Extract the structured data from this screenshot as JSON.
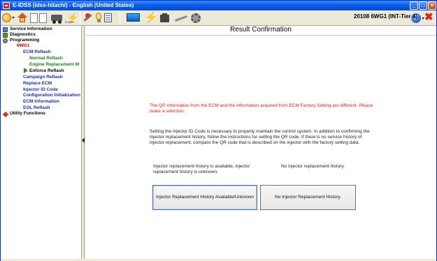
{
  "window": {
    "title": "E-IDSS (idss-hitachi) - English (United States)",
    "min_glyph": "_",
    "max_glyph": "□",
    "close_glyph": "×"
  },
  "toolbar": {
    "flash_label": "FLASH",
    "vehicle_info": "20108 6WG1 (INT-Tier 4)",
    "help_glyph": "?",
    "exit_glyph": "✖",
    "bolt_glyph": "⚡"
  },
  "sidebar": {
    "items": [
      {
        "label": "Service Information",
        "level": 0
      },
      {
        "label": "Diagnostics",
        "level": 0
      },
      {
        "label": "Programming",
        "level": 0
      },
      {
        "label": "6WG1",
        "level": 1
      },
      {
        "label": "ECM Reflash",
        "level": 2
      },
      {
        "label": "Normal Reflash",
        "level": 3
      },
      {
        "label": "Engine Replacement M",
        "level": 3
      },
      {
        "label": "Enforce Reflash",
        "level": 3,
        "selected": true
      },
      {
        "label": "Campaign Reflash",
        "level": 2
      },
      {
        "label": "Replace ECM",
        "level": 2
      },
      {
        "label": "Injector ID Code",
        "level": 2
      },
      {
        "label": "Configuration Initialization",
        "level": 2
      },
      {
        "label": "ECM Information",
        "level": 2
      },
      {
        "label": "EOL Reflash",
        "level": 2
      },
      {
        "label": "Utility Functions",
        "level": 0
      }
    ]
  },
  "main": {
    "title": "Result Confirmation",
    "warning": "The QR information from the ECM and the information acquired from ECM Factory Setting are different. Please make a selection.",
    "instruction": "Setting the Injector ID Code is necessary to properly maintain the control system. In addition to confirming the injector replacement history, follow the instructions for setting the QR code. If there is no service history of injector replacement, compare the QR code that is described on the injector with the factory setting data.",
    "option1_desc": "Injector replacement history is available, injector replacement history is unknown.",
    "option2_desc": "No injector replacement history.",
    "option1_button": "Injector Replacement History Available/Unknown",
    "option2_button": "No Injector Replacement History."
  },
  "colors": {
    "titlebar": "#0a5fe6",
    "warning_text": "#e0231b",
    "nav_blue": "#1f2f9f",
    "nav_green": "#1f7a1f",
    "nav_red": "#c00000"
  }
}
